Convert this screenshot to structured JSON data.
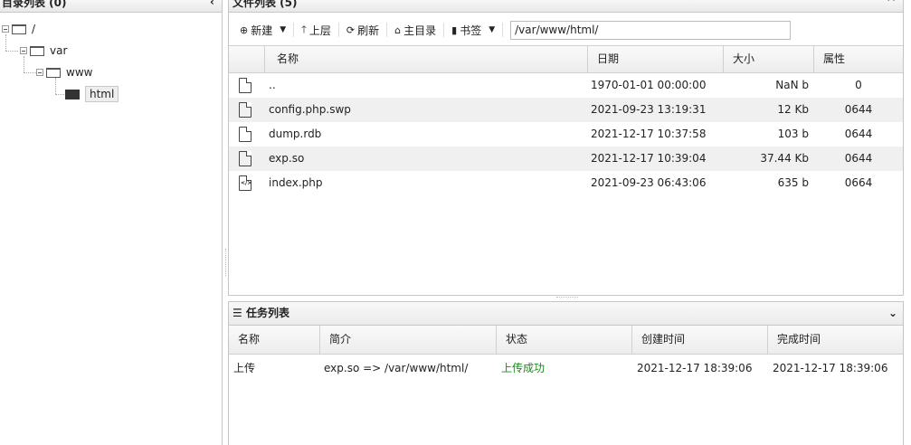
{
  "dir_panel": {
    "title": "目录列表 (0)",
    "collapse_glyph": "‹",
    "tree": [
      {
        "label": "/"
      },
      {
        "label": "var"
      },
      {
        "label": "www"
      },
      {
        "label": "html"
      }
    ]
  },
  "file_panel": {
    "title": "文件列表 (5)",
    "collapse_glyph": "^",
    "toolbar": {
      "new_label": "新建",
      "up_label": "上层",
      "refresh_label": "刷新",
      "home_label": "主目录",
      "bookmark_label": "书签",
      "path": "/var/www/html/"
    },
    "columns": {
      "name": "名称",
      "date": "日期",
      "size": "大小",
      "attr": "属性"
    },
    "rows": [
      {
        "name": "..",
        "date": "1970-01-01 00:00:00",
        "size": "NaN b",
        "attr": "0",
        "icon": "file-icon"
      },
      {
        "name": "config.php.swp",
        "date": "2021-09-23 13:19:31",
        "size": "12 Kb",
        "attr": "0644",
        "icon": "file-icon"
      },
      {
        "name": "dump.rdb",
        "date": "2021-12-17 10:37:58",
        "size": "103 b",
        "attr": "0644",
        "icon": "file-icon"
      },
      {
        "name": "exp.so",
        "date": "2021-12-17 10:39:04",
        "size": "37.44 Kb",
        "attr": "0644",
        "icon": "file-icon"
      },
      {
        "name": "index.php",
        "date": "2021-09-23 06:43:06",
        "size": "635 b",
        "attr": "0664",
        "icon": "code-file-icon"
      }
    ]
  },
  "task_panel": {
    "title": "任务列表",
    "collapse_glyph": "⌄",
    "columns": {
      "name": "名称",
      "desc": "简介",
      "status": "状态",
      "created": "创建时间",
      "finished": "完成时间"
    },
    "rows": [
      {
        "name": "上传",
        "desc": "exp.so => /var/www/html/",
        "status": "上传成功",
        "created": "2021-12-17 18:39:06",
        "finished": "2021-12-17 18:39:06"
      }
    ],
    "status_color": "#1a8a1a"
  }
}
